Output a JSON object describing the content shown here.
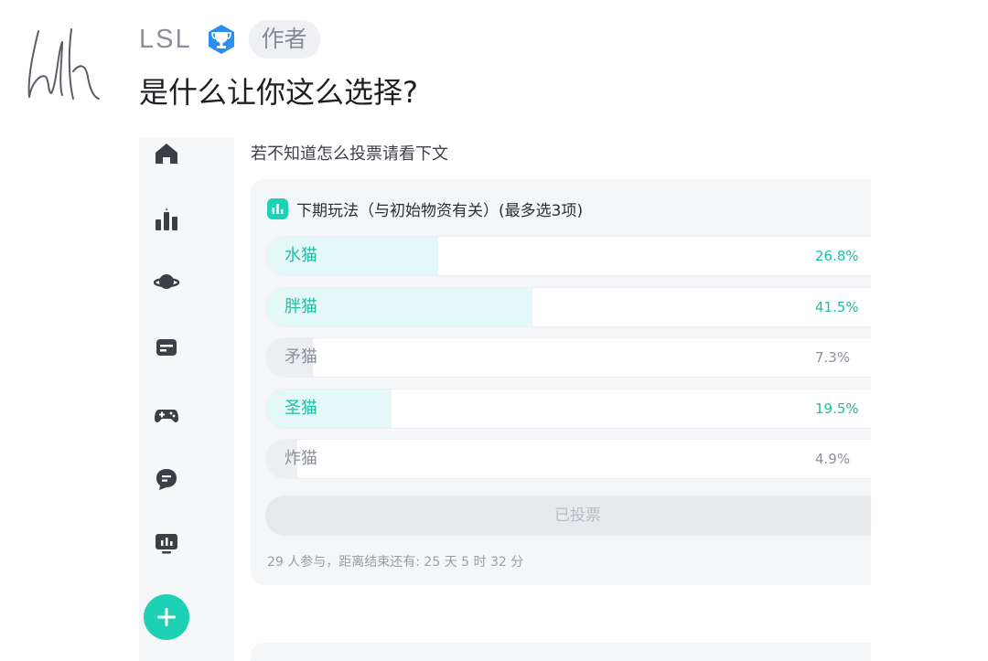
{
  "comment": {
    "author_name": "LSL",
    "author_tag": "作者",
    "text": "是什么让你这么选择?"
  },
  "post": {
    "hint": "若不知道怎么投票请看下文",
    "poll": {
      "title": "下期玩法（与初始物资有关）(最多选3项)",
      "options": [
        {
          "label": "水猫",
          "percent_text": "26.8%",
          "percent": 26.8,
          "selected": true
        },
        {
          "label": "胖猫",
          "percent_text": "41.5%",
          "percent": 41.5,
          "selected": true
        },
        {
          "label": "矛猫",
          "percent_text": "7.3%",
          "percent": 7.3,
          "selected": false
        },
        {
          "label": "圣猫",
          "percent_text": "19.5%",
          "percent": 19.5,
          "selected": true
        },
        {
          "label": "炸猫",
          "percent_text": "4.9%",
          "percent": 4.9,
          "selected": false
        }
      ],
      "vote_button_label": "已投票",
      "meta": "29 人参与，距离结束还有: 25 天 5 时 32 分"
    }
  },
  "sidebar": {
    "icons": [
      "home-icon",
      "ranking-icon",
      "planet-icon",
      "card-icon",
      "gamepad-icon",
      "chat-icon",
      "monitor-chart-icon"
    ],
    "add_icon": "plus-icon"
  },
  "colors": {
    "accent": "#1fd1b4",
    "selected_text": "#1fbfa6",
    "selected_fill": "#e3f8f7",
    "unselected_fill": "#eceef1",
    "badge_blue": "#2a8ff0"
  }
}
